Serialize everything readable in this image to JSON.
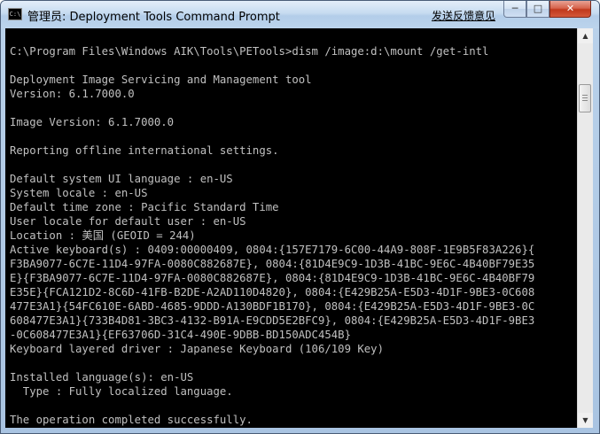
{
  "window": {
    "title": "管理员: Deployment Tools Command Prompt",
    "feedback_link": "发送反馈意见",
    "app_icon_text": "C:\\",
    "controls": {
      "minimize": "─",
      "maximize": "□",
      "close": "✕"
    }
  },
  "console": {
    "lines": [
      "",
      "C:\\Program Files\\Windows AIK\\Tools\\PETools>dism /image:d:\\mount /get-intl",
      "",
      "Deployment Image Servicing and Management tool",
      "Version: 6.1.7000.0",
      "",
      "Image Version: 6.1.7000.0",
      "",
      "Reporting offline international settings.",
      "",
      "Default system UI language : en-US",
      "System locale : en-US",
      "Default time zone : Pacific Standard Time",
      "User locale for default user : en-US",
      "Location : 美国 (GEOID = 244)",
      "Active keyboard(s) : 0409:00000409, 0804:{157E7179-6C00-44A9-808F-1E9B5F83A226}{",
      "F3BA9077-6C7E-11D4-97FA-0080C882687E}, 0804:{81D4E9C9-1D3B-41BC-9E6C-4B40BF79E35",
      "E}{F3BA9077-6C7E-11D4-97FA-0080C882687E}, 0804:{81D4E9C9-1D3B-41BC-9E6C-4B40BF79",
      "E35E}{FCA121D2-8C6D-41FB-B2DE-A2AD110D4820}, 0804:{E429B25A-E5D3-4D1F-9BE3-0C608",
      "477E3A1}{54FC610E-6ABD-4685-9DDD-A130BDF1B170}, 0804:{E429B25A-E5D3-4D1F-9BE3-0C",
      "608477E3A1}{733B4D81-3BC3-4132-B91A-E9CDD5E2BFC9}, 0804:{E429B25A-E5D3-4D1F-9BE3",
      "-0C608477E3A1}{EF63706D-31C4-490E-9DBB-BD150ADC454B}",
      "Keyboard layered driver : Japanese Keyboard (106/109 Key)",
      "",
      "Installed language(s): en-US",
      "  Type : Fully localized language.",
      "",
      "The operation completed successfully."
    ]
  },
  "scrollbar": {
    "up_arrow": "▲",
    "down_arrow": "▼",
    "position": 0.12
  },
  "colors": {
    "console_background": "#000000",
    "console_text": "#c0c0c0",
    "titlebar": "#b9d1ea",
    "close_button": "#c7432a"
  }
}
